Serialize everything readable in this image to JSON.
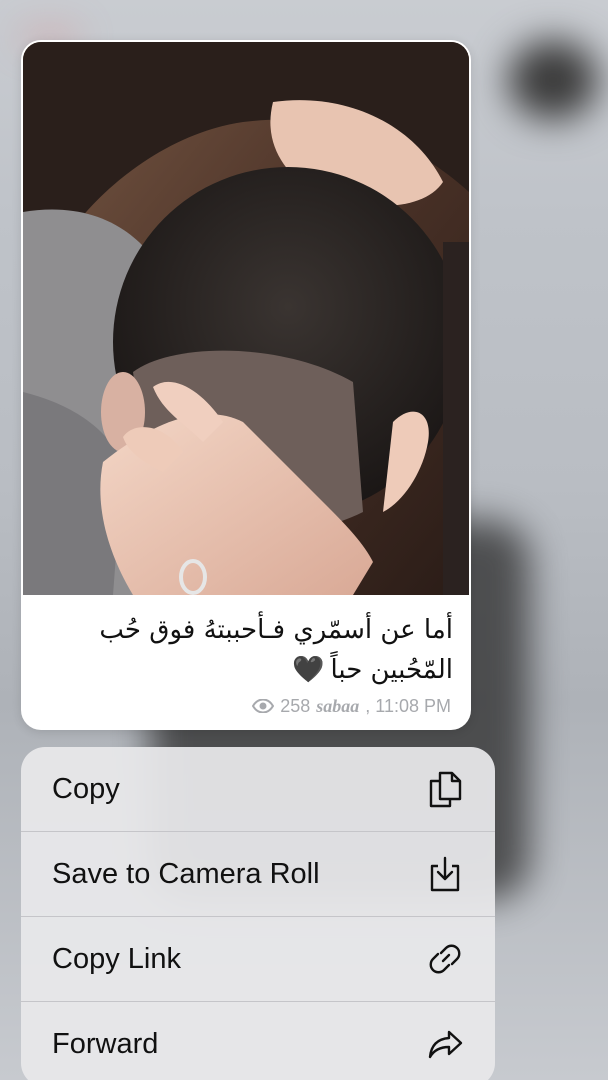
{
  "message": {
    "caption_line1": "أما عن أسمّري فـأحببتهُ فوق حُب",
    "caption_line2": "المّحُبين حباً",
    "heart": "🖤",
    "views": "258",
    "author": "sabaa",
    "time": ", 11:08 PM"
  },
  "menu": {
    "items": [
      {
        "label": "Copy",
        "icon": "copy-icon"
      },
      {
        "label": "Save to Camera Roll",
        "icon": "save-download-icon"
      },
      {
        "label": "Copy Link",
        "icon": "link-icon"
      },
      {
        "label": "Forward",
        "icon": "forward-arrow-icon"
      }
    ]
  },
  "colors": {
    "bubble_bg": "#ffffff",
    "meta_text": "#a7a9ad",
    "menu_bg": "#e8e8ea"
  }
}
